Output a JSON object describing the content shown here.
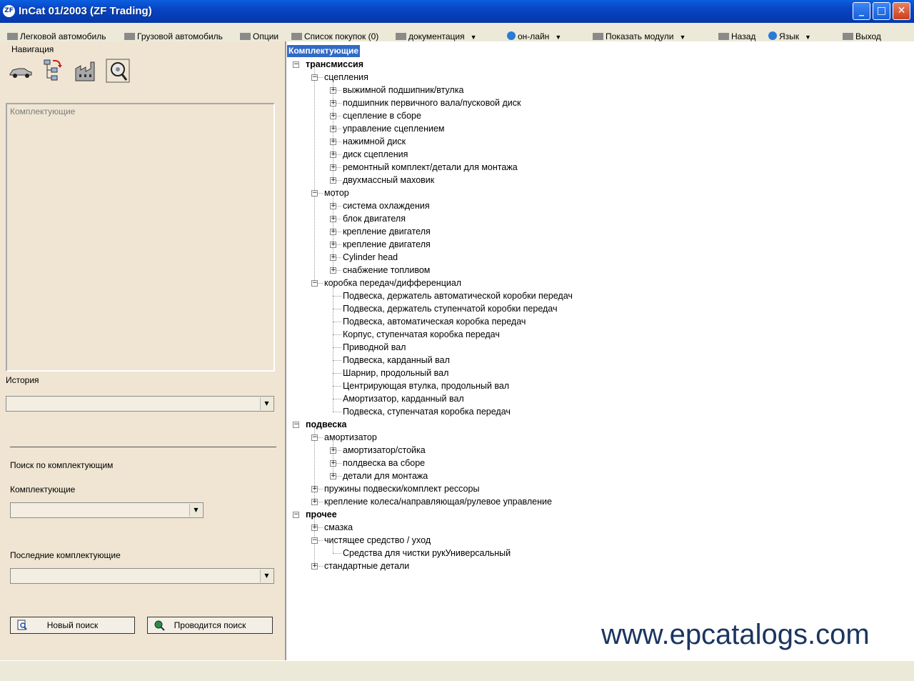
{
  "window": {
    "title": "InCat 01/2003 (ZF Trading)",
    "app_icon": "ZF",
    "controls": {
      "minimize": "_",
      "maximize": "□",
      "close": "✕"
    }
  },
  "menu": [
    {
      "label": "Легковой автомобиль",
      "icon": "car-icon"
    },
    {
      "label": "Грузовой автомобиль",
      "icon": "truck-icon"
    },
    {
      "label": "Опции",
      "icon": "options-icon"
    },
    {
      "label": "Список покупок (0)",
      "icon": "cart-icon"
    },
    {
      "label": "документация",
      "icon": "document-icon",
      "caret": "▼"
    },
    {
      "label": "он-лайн",
      "icon": "globe-icon",
      "caret": "▼"
    },
    {
      "label": "Показать модули",
      "icon": "modules-icon",
      "caret": "▼"
    },
    {
      "label": "Назад",
      "icon": "back-icon"
    },
    {
      "label": "Язык",
      "icon": "globe-icon",
      "caret": "▼"
    },
    {
      "label": "Выход",
      "icon": "exit-icon"
    }
  ],
  "left": {
    "nav_heading": "Навигация",
    "nav_buttons": [
      "car-icon",
      "tree-structure-icon",
      "factory-icon",
      "magnifier-icon"
    ],
    "components_box_text": "Комплектующие",
    "history_label": "История",
    "history_value": "",
    "search_heading": "Поиск по комплектующим",
    "components_label": "Комплектующие",
    "components_value": "",
    "recent_label": "Последние комплектующие",
    "recent_value": "",
    "dropdown_arrow": "▼",
    "new_search_button": "Новый поиск",
    "run_search_button": "Проводится поиск"
  },
  "tree": {
    "header": "Комплектующие",
    "nodes": [
      {
        "label": "трансмиссия",
        "level": 0,
        "state": "expanded",
        "bold": true
      },
      {
        "label": "сцепления",
        "level": 1,
        "state": "expanded"
      },
      {
        "label": "выжимной подшипник/втулка",
        "level": 2,
        "state": "collapsed"
      },
      {
        "label": "подшипник первичного вала/пусковой диск",
        "level": 2,
        "state": "collapsed"
      },
      {
        "label": "сцепление в сборе",
        "level": 2,
        "state": "collapsed"
      },
      {
        "label": "управление сцеплением",
        "level": 2,
        "state": "collapsed"
      },
      {
        "label": "нажимной диск",
        "level": 2,
        "state": "collapsed"
      },
      {
        "label": "диск сцепления",
        "level": 2,
        "state": "collapsed"
      },
      {
        "label": "ремонтный комплект/детали для монтажа",
        "level": 2,
        "state": "collapsed"
      },
      {
        "label": "двухмассный маховик",
        "level": 2,
        "state": "collapsed"
      },
      {
        "label": "мотор",
        "level": 1,
        "state": "expanded"
      },
      {
        "label": "система охлаждения",
        "level": 2,
        "state": "collapsed"
      },
      {
        "label": "блок двигателя",
        "level": 2,
        "state": "collapsed"
      },
      {
        "label": "крепление двигателя",
        "level": 2,
        "state": "collapsed"
      },
      {
        "label": "крепление двигателя",
        "level": 2,
        "state": "collapsed"
      },
      {
        "label": "Cylinder head",
        "level": 2,
        "state": "collapsed"
      },
      {
        "label": "снабжение топливом",
        "level": 2,
        "state": "collapsed"
      },
      {
        "label": "коробка передач/дифференциал",
        "level": 1,
        "state": "expanded"
      },
      {
        "label": "Подвеска, держатель автоматической коробки передач",
        "level": 2,
        "state": "leaf"
      },
      {
        "label": "Подвеска, держатель ступенчатой коробки передач",
        "level": 2,
        "state": "leaf"
      },
      {
        "label": "Подвеска, автоматическая коробка передач",
        "level": 2,
        "state": "leaf"
      },
      {
        "label": "Корпус, ступенчатая коробка передач",
        "level": 2,
        "state": "leaf"
      },
      {
        "label": "Приводной вал",
        "level": 2,
        "state": "leaf"
      },
      {
        "label": "Подвеска, карданный вал",
        "level": 2,
        "state": "leaf"
      },
      {
        "label": "Шарнир, продольный вал",
        "level": 2,
        "state": "leaf"
      },
      {
        "label": "Центрирующая втулка, продольный вал",
        "level": 2,
        "state": "leaf"
      },
      {
        "label": "Амортизатор, карданный вал",
        "level": 2,
        "state": "leaf"
      },
      {
        "label": "Подвеска, ступенчатая коробка передач",
        "level": 2,
        "state": "leaf"
      },
      {
        "label": "подвеска",
        "level": 0,
        "state": "expanded",
        "bold": true
      },
      {
        "label": "амортизатор",
        "level": 1,
        "state": "expanded"
      },
      {
        "label": "амортизатор/стойка",
        "level": 2,
        "state": "collapsed"
      },
      {
        "label": "полдвеска ва сборе",
        "level": 2,
        "state": "collapsed"
      },
      {
        "label": "детали для монтажа",
        "level": 2,
        "state": "collapsed"
      },
      {
        "label": "пружины подвески/комплект рессоры",
        "level": 1,
        "state": "collapsed"
      },
      {
        "label": "крепление колеса/направляющая/рулевое управление",
        "level": 1,
        "state": "collapsed"
      },
      {
        "label": "прочее",
        "level": 0,
        "state": "expanded",
        "bold": true
      },
      {
        "label": "смазка",
        "level": 1,
        "state": "collapsed"
      },
      {
        "label": "чистящее средство / уход",
        "level": 1,
        "state": "expanded"
      },
      {
        "label": "Средства для чистки рукУниверсальный",
        "level": 2,
        "state": "leaf"
      },
      {
        "label": "стандартные детали",
        "level": 1,
        "state": "collapsed"
      }
    ]
  },
  "watermark": "www.epcatalogs.com",
  "colors": {
    "title_bar": "#0a5fe0",
    "selection": "#316ac5",
    "watermark": "#1a3560"
  }
}
